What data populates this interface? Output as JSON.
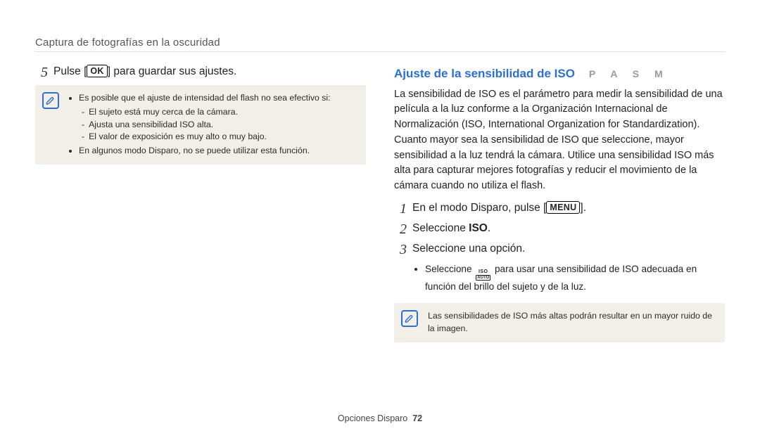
{
  "chapter_title": "Captura de fotografías en la oscuridad",
  "left": {
    "step5": {
      "num": "5",
      "pre": "Pulse [",
      "ok": "OK",
      "post": "] para guardar sus ajustes."
    },
    "note": {
      "bullet1": "Es posible que el ajuste de intensidad del flash no sea efectivo si:",
      "sub1": "El sujeto está muy cerca de la cámara.",
      "sub2": "Ajusta una sensibilidad ISO alta.",
      "sub3": "El valor de exposición es muy alto o muy bajo.",
      "bullet2": "En algunos modo Disparo, no se puede utilizar esta función."
    }
  },
  "right": {
    "heading": "Ajuste de la sensibilidad de ISO",
    "modes": "P A S M",
    "intro": "La sensibilidad de ISO es el parámetro para medir la sensibilidad de una película a la luz conforme a la Organización Internacional de Normalización (ISO, International Organization for Standardization). Cuanto mayor sea la sensibilidad de ISO que seleccione, mayor sensibilidad a la luz tendrá la cámara. Utilice una sensibilidad ISO más alta para capturar mejores fotografías y reducir el movimiento de la cámara cuando no utiliza el flash.",
    "step1": {
      "num": "1",
      "pre": "En el modo Disparo, pulse [",
      "menu": "MENU",
      "post": "]."
    },
    "step2": {
      "num": "2",
      "text_a": "Seleccione ",
      "bold": "ISO",
      "text_b": "."
    },
    "step3": {
      "num": "3",
      "text": "Seleccione una opción."
    },
    "sub": {
      "pre": "Seleccione ",
      "iso_top": "ISO",
      "iso_bot": "AUTO",
      "post": " para usar una sensibilidad de ISO adecuada en función del brillo del sujeto y de la luz."
    },
    "note": "Las sensibilidades de ISO más altas podrán resultar en un mayor ruido de la imagen."
  },
  "footer": {
    "label": "Opciones Disparo",
    "page": "72"
  }
}
